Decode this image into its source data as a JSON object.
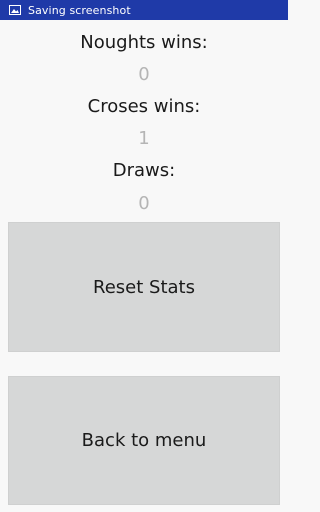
{
  "status_bar": {
    "notification_text": "Saving screenshot",
    "icon": "image-icon",
    "background_color": "#1f3aa8"
  },
  "stats": {
    "noughts_label": "Noughts wins:",
    "noughts_value": "0",
    "crosses_label": "Croses wins:",
    "crosses_value": "1",
    "draws_label": "Draws:",
    "draws_value": "0"
  },
  "buttons": {
    "reset_label": "Reset Stats",
    "back_label": "Back to menu"
  }
}
